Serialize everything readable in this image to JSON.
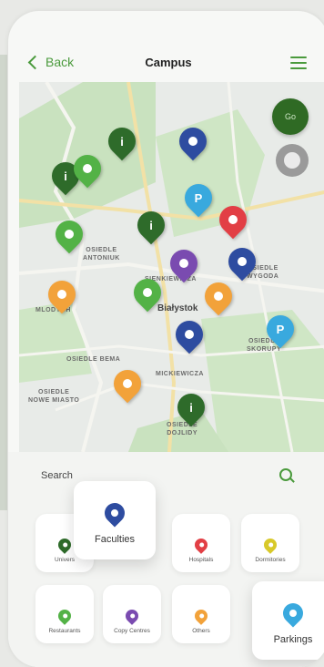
{
  "header": {
    "back_label": "Back",
    "title": "Campus"
  },
  "map": {
    "my_location_label": "Go",
    "labels": [
      {
        "id": "antoniuk",
        "text": "OSIEDLE\nANTONIUK"
      },
      {
        "id": "wygoda",
        "text": "OSIEDLE\nWYGODA"
      },
      {
        "id": "mlodych",
        "text": "MLODYCH"
      },
      {
        "id": "bialystok",
        "text": "Białystok"
      },
      {
        "id": "bema",
        "text": "OSIEDLE BEMA"
      },
      {
        "id": "nowe-miasto",
        "text": "OSIEDLE\nNOWE MIASTO"
      },
      {
        "id": "mickiewicza",
        "text": "MICKIEWICZA"
      },
      {
        "id": "dojlidy",
        "text": "OSIEDLE\nDOJLIDY"
      },
      {
        "id": "sienkiewicza",
        "text": "SIENKIEWICZA"
      },
      {
        "id": "skorupy",
        "text": "OSIEDLE\nSKORUPY"
      }
    ],
    "pins": [
      {
        "type": "university",
        "color": "#2e6b2a",
        "glyph": "i"
      },
      {
        "type": "university",
        "color": "#2e6b2a",
        "glyph": "i"
      },
      {
        "type": "restaurant",
        "color": "#53b246",
        "glyph": ""
      },
      {
        "type": "faculty",
        "color": "#2e4ca0",
        "glyph": ""
      },
      {
        "type": "parking",
        "color": "#39a9de",
        "glyph": "P"
      },
      {
        "type": "university",
        "color": "#2e6b2a",
        "glyph": "i"
      },
      {
        "type": "hospital",
        "color": "#e23f45",
        "glyph": ""
      },
      {
        "type": "restaurant",
        "color": "#53b246",
        "glyph": ""
      },
      {
        "type": "copy-centre",
        "color": "#7a4bb0",
        "glyph": ""
      },
      {
        "type": "faculty",
        "color": "#2e4ca0",
        "glyph": ""
      },
      {
        "type": "other",
        "color": "#f2a23a",
        "glyph": ""
      },
      {
        "type": "restaurant",
        "color": "#53b246",
        "glyph": ""
      },
      {
        "type": "other",
        "color": "#f2a23a",
        "glyph": ""
      },
      {
        "type": "parking",
        "color": "#39a9de",
        "glyph": "P"
      },
      {
        "type": "faculty",
        "color": "#2e4ca0",
        "glyph": ""
      },
      {
        "type": "other",
        "color": "#f2a23a",
        "glyph": ""
      },
      {
        "type": "university",
        "color": "#2e6b2a",
        "glyph": "i"
      }
    ]
  },
  "panel": {
    "search_label": "Search",
    "categories": [
      {
        "id": "univers",
        "label": "Univers",
        "color": "#2e6b2a"
      },
      {
        "id": "faculties",
        "label": "Faculties",
        "color": "#2e4ca0"
      },
      {
        "id": "hospitals",
        "label": "Hospitals",
        "color": "#e23f45"
      },
      {
        "id": "dormitories",
        "label": "Dormitories",
        "color": "#d8c92a"
      },
      {
        "id": "restaurants",
        "label": "Restaurants",
        "color": "#53b246"
      },
      {
        "id": "copy-centres",
        "label": "Copy Centres",
        "color": "#7a4bb0"
      },
      {
        "id": "others",
        "label": "Others",
        "color": "#f2a23a"
      },
      {
        "id": "parkings",
        "label": "Parkings",
        "color": "#39a9de"
      }
    ]
  }
}
